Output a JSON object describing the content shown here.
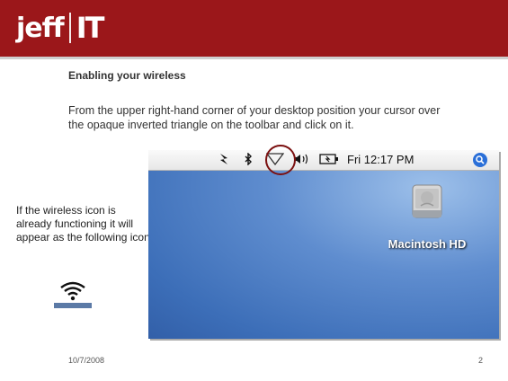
{
  "header": {
    "logo_part1": "jeff",
    "logo_part2": "IT",
    "color": "#9b171a"
  },
  "content": {
    "heading": "Enabling your wireless",
    "paragraph": "From the upper right-hand corner of your desktop position your cursor over the opaque inverted triangle on the toolbar and click on it.",
    "side_note": "If the wireless icon is already functioning it will appear as the following icon",
    "wireless_icon": "wifi-icon"
  },
  "screenshot": {
    "clock": "Fri 12:17 PM",
    "drive_label": "Macintosh HD",
    "menubar_icons": [
      "sync-icon",
      "bluetooth-icon",
      "airport-triangle-icon",
      "volume-icon",
      "battery-icon",
      "spotlight-icon"
    ],
    "highlight_color": "#7b1010"
  },
  "footer": {
    "date": "10/7/2008",
    "page_number": "2"
  }
}
